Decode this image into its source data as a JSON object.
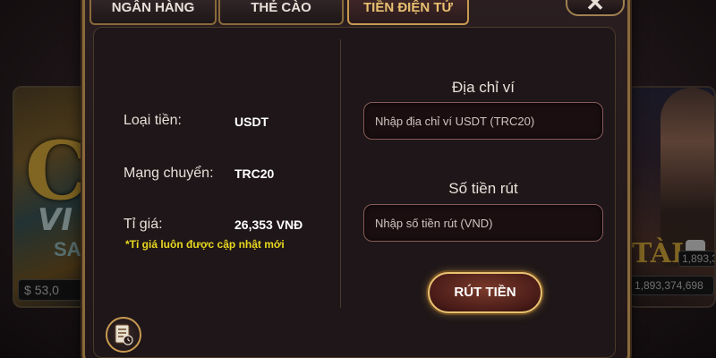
{
  "background": {
    "left_card": {
      "title_letters": "C",
      "title_vi": "VI",
      "title_sai": "SAI",
      "amount": "53,0"
    },
    "right_card": {
      "title": "TÀI",
      "amount_1": "1,893,3",
      "amount_2": "1,893,374,698"
    }
  },
  "tabs": [
    {
      "label": "NGÂN HÀNG"
    },
    {
      "label": "THẺ CÀO"
    },
    {
      "label": "TIỀN ĐIỆN TỬ"
    }
  ],
  "close": {
    "symbol": "✕"
  },
  "info": {
    "currency_label": "Loại tiền:",
    "currency_value": "USDT",
    "network_label": "Mạng chuyển:",
    "network_value": "TRC20",
    "rate_label": "Tỉ giá:",
    "rate_value": "26,353 VNĐ",
    "rate_note": "*Tỉ giá luôn được cập nhật mới"
  },
  "form": {
    "wallet_title": "Địa chỉ ví",
    "wallet_placeholder": "Nhập địa chỉ ví USDT (TRC20)",
    "amount_title": "Số tiền rút",
    "amount_placeholder": "Nhập số tiền rút (VND)",
    "submit_label": "RÚT TIỀN"
  },
  "colors": {
    "accent_gold": "#c89a50",
    "note_yellow": "#e8d820"
  }
}
